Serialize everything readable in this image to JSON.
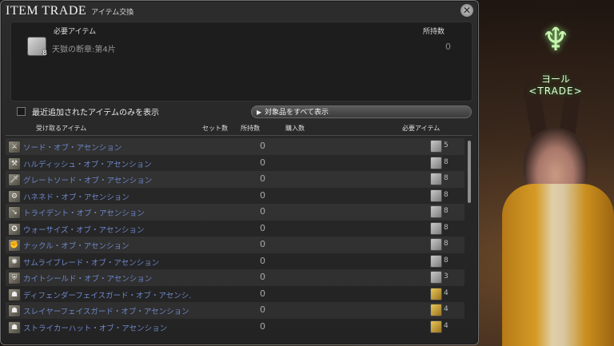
{
  "window": {
    "title": "ITEM TRADE",
    "subtitle": "アイテム交換",
    "close_icon": "close-icon"
  },
  "required_panel": {
    "item_header": "必要アイテム",
    "have_header": "所持数",
    "item_name": "天獄の断章:第4片",
    "item_icon_count": "8",
    "have_value": "0"
  },
  "filter": {
    "recent_only_label": "最近追加されたアイテムのみを表示",
    "show_all_button": "対象品をすべて表示"
  },
  "columns": {
    "receive": "受け取るアイテム",
    "sets": "セット数",
    "have": "所持数",
    "purchase": "購入数",
    "required": "必要アイテム"
  },
  "rows": [
    {
      "icon": "⚔",
      "name": "ソード・オブ・アセンション",
      "have": "0",
      "req": "5",
      "req_color": "silver"
    },
    {
      "icon": "⚒",
      "name": "ハルディッシュ・オブ・アセンション",
      "have": "0",
      "req": "8",
      "req_color": "silver"
    },
    {
      "icon": "🗡",
      "name": "グレートソード・オブ・アセンション",
      "have": "0",
      "req": "8",
      "req_color": "silver"
    },
    {
      "icon": "⚙",
      "name": "ハネネド・オブ・アセンション",
      "have": "0",
      "req": "8",
      "req_color": "silver"
    },
    {
      "icon": "↘",
      "name": "トライデント・オブ・アセンション",
      "have": "0",
      "req": "8",
      "req_color": "silver"
    },
    {
      "icon": "✪",
      "name": "ウォーサイズ・オブ・アセンション",
      "have": "0",
      "req": "8",
      "req_color": "silver"
    },
    {
      "icon": "✊",
      "name": "ナックル・オブ・アセンション",
      "have": "0",
      "req": "8",
      "req_color": "silver"
    },
    {
      "icon": "✺",
      "name": "サムライブレード・オブ・アセンション",
      "have": "0",
      "req": "8",
      "req_color": "silver"
    },
    {
      "icon": "⛨",
      "name": "カイトシールド・オブ・アセンション",
      "have": "0",
      "req": "3",
      "req_color": "silver"
    },
    {
      "icon": "☗",
      "name": "ディフェンダーフェイスガード・オブ・アセンシ…",
      "have": "0",
      "req": "4",
      "req_color": "gold"
    },
    {
      "icon": "☗",
      "name": "スレイヤーフェイスガード・オブ・アセンション",
      "have": "0",
      "req": "4",
      "req_color": "gold"
    },
    {
      "icon": "☗",
      "name": "ストライカーハット・オブ・アセンション",
      "have": "0",
      "req": "4",
      "req_color": "gold"
    }
  ],
  "npc": {
    "name": "ヨール",
    "label": "<TRADE>"
  }
}
